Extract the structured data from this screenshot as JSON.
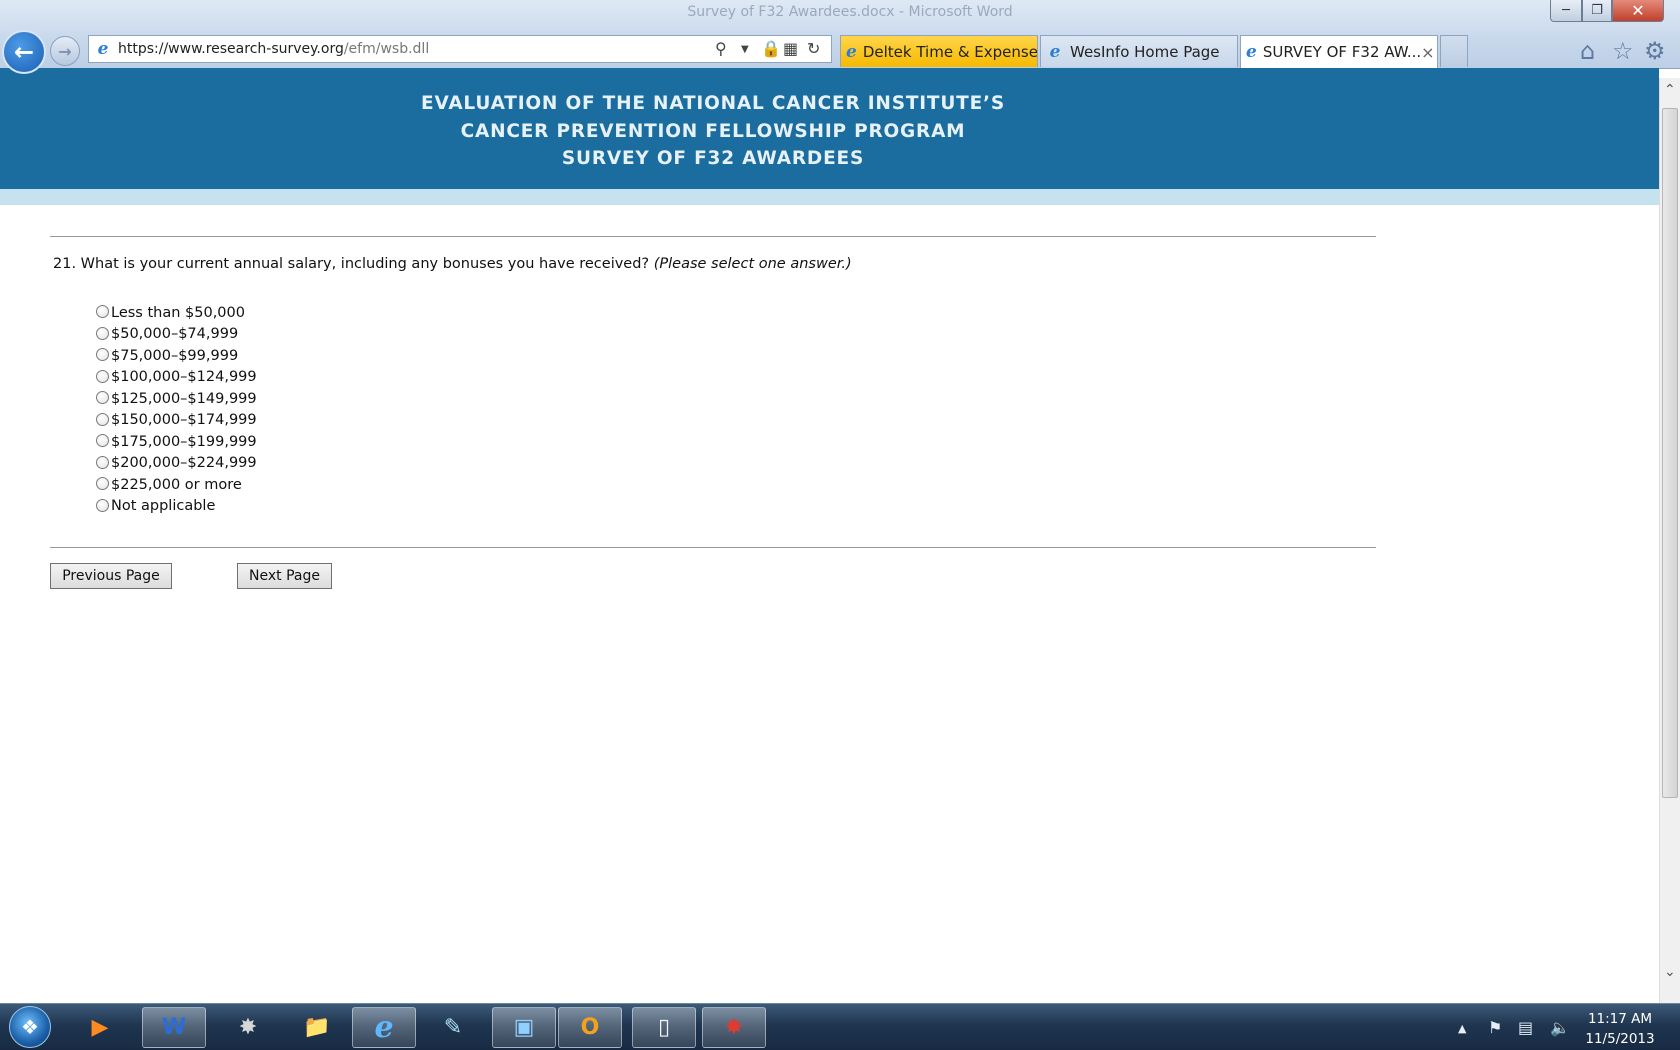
{
  "window": {
    "title": "Survey of F32 Awardees.docx - Microsoft Word",
    "min_icon": "minimize-icon",
    "max_icon": "restore-icon",
    "close_icon": "close-icon"
  },
  "browser": {
    "url_main": "https://www.research-survey.org",
    "url_path": "/efm/wsb.dll",
    "tabs": [
      {
        "label": "Deltek Time & Expense...",
        "color": "#f6b900"
      },
      {
        "label": "WesInfo Home Page"
      },
      {
        "label": "SURVEY OF F32 AW..."
      }
    ],
    "tab_close_glyph": "×",
    "toolbar_icons": [
      "home-icon",
      "star-icon",
      "gear-icon"
    ]
  },
  "page": {
    "header": {
      "line1": "EVALUATION OF THE NATIONAL CANCER INSTITUTE’S",
      "line2": "CANCER PREVENTION FELLOWSHIP PROGRAM",
      "line3": "SURVEY OF F32 AWARDEES"
    },
    "question": {
      "text": "21. What is your current annual salary, including any bonuses you have received?",
      "instruction": "(Please select one answer.)"
    },
    "options": [
      "Less than $50,000",
      "$50,000–$74,999",
      "$75,000–$99,999",
      "$100,000–$124,999",
      "$125,000–$149,999",
      "$150,000–$174,999",
      "$175,000–$199,999",
      "$200,000–$224,999",
      "$225,000 or more",
      "Not applicable"
    ],
    "buttons": {
      "previous": "Previous Page",
      "next": "Next Page"
    },
    "colors": {
      "header_band": "#1a6d9e",
      "sub_band": "#c6e2ef"
    }
  },
  "taskbar": {
    "apps": [
      "media-player-icon",
      "word-icon",
      "acrobat-icon",
      "file-explorer-icon",
      "internet-explorer-icon",
      "notes-icon",
      "remote-desktop-icon",
      "outlook-icon",
      "blank-document-icon",
      "pdf-icon"
    ],
    "clock": {
      "time": "11:17 AM",
      "date": "11/5/2013"
    }
  }
}
